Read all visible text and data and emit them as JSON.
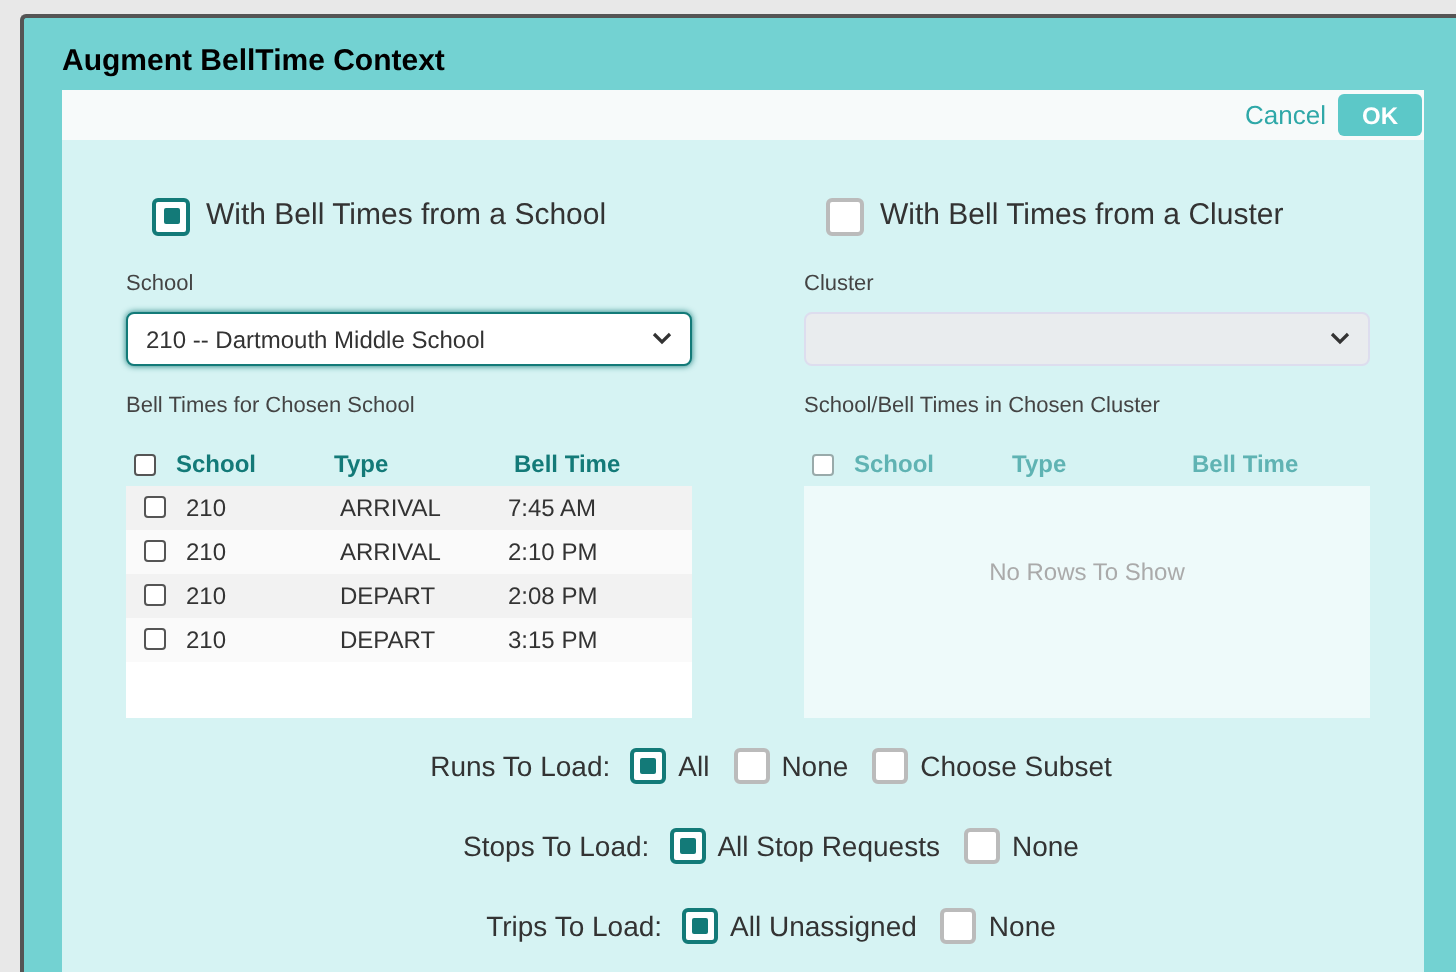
{
  "dialog": {
    "title": "Augment BellTime Context"
  },
  "actions": {
    "cancel": "Cancel",
    "ok": "OK"
  },
  "sources": [
    {
      "label": "With Bell Times from a School",
      "selected": true
    },
    {
      "label": "With Bell Times from a Cluster",
      "selected": false
    }
  ],
  "school_select": {
    "label": "School",
    "value": "210 -- Dartmouth Middle School",
    "disabled": false
  },
  "cluster_select": {
    "label": "Cluster",
    "disabled": true
  },
  "school_table": {
    "title": "Bell Times for Chosen School",
    "disabled": false,
    "header_checked": false,
    "columns": [
      "School",
      "Type",
      "Bell Time"
    ],
    "rows": [
      {
        "cells": [
          "210",
          "ARRIVAL",
          "7:45 AM"
        ],
        "checked": false
      },
      {
        "cells": [
          "210",
          "ARRIVAL",
          "2:10 PM"
        ],
        "checked": false
      },
      {
        "cells": [
          "210",
          "DEPART",
          "2:08 PM"
        ],
        "checked": false
      },
      {
        "cells": [
          "210",
          "DEPART",
          "3:15 PM"
        ],
        "checked": false
      }
    ]
  },
  "cluster_table": {
    "title": "School/Bell Times in Chosen Cluster",
    "disabled": true,
    "header_checked": false,
    "columns": [
      "School",
      "Type",
      "Bell Time"
    ],
    "empty_text": "No Rows To Show"
  },
  "load_options": [
    {
      "label": "Runs To Load:",
      "choices": [
        {
          "label": "All",
          "selected": true
        },
        {
          "label": "None",
          "selected": false
        },
        {
          "label": "Choose Subset",
          "selected": false
        }
      ]
    },
    {
      "label": "Stops To Load:",
      "choices": [
        {
          "label": "All Stop Requests",
          "selected": true
        },
        {
          "label": "None",
          "selected": false
        }
      ]
    },
    {
      "label": "Trips To Load:",
      "choices": [
        {
          "label": "All Unassigned",
          "selected": true
        },
        {
          "label": "None",
          "selected": false
        }
      ]
    }
  ]
}
